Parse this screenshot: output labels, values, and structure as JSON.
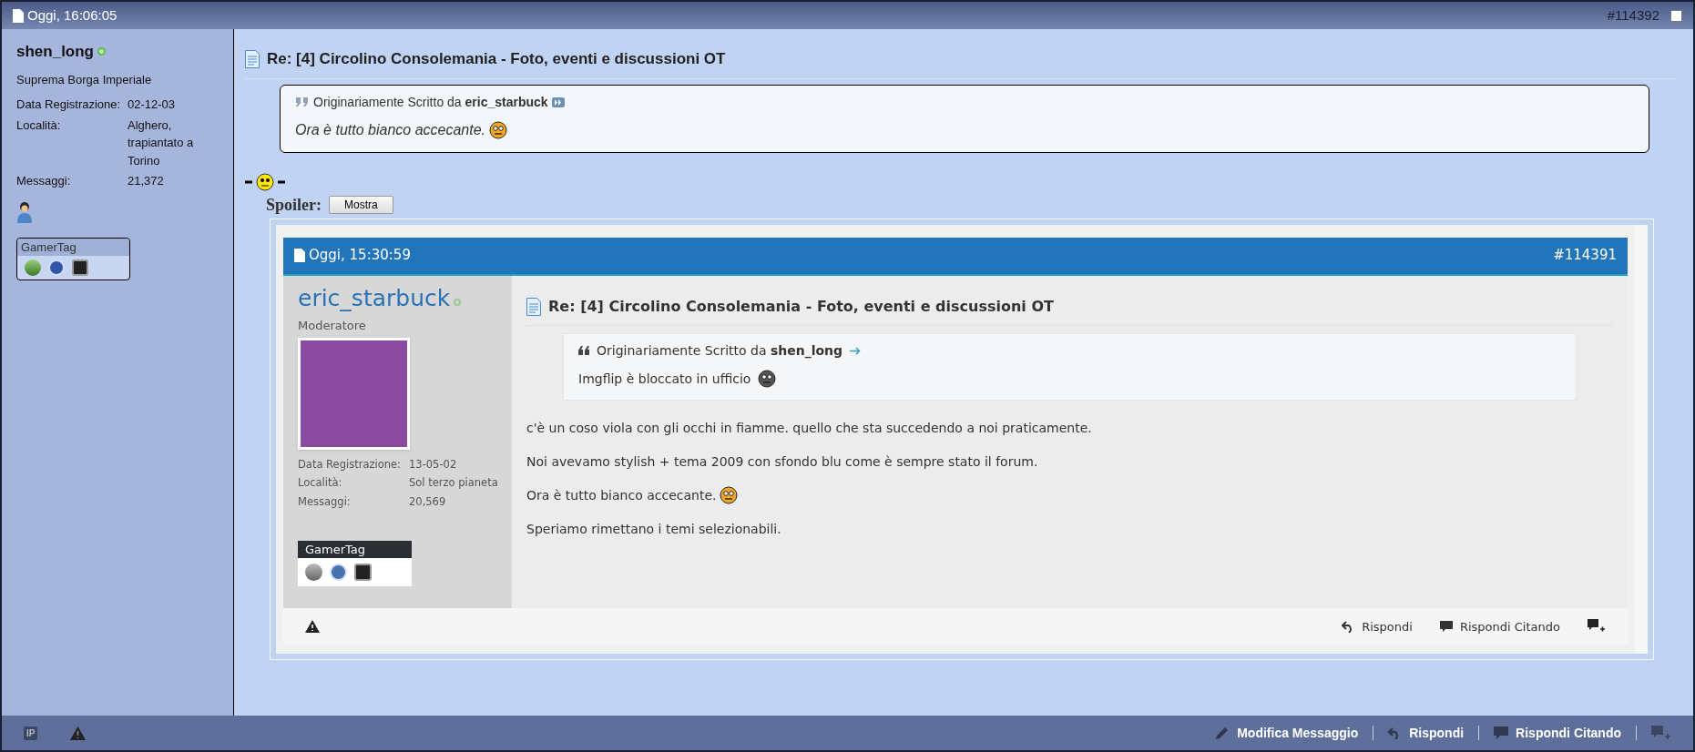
{
  "post": {
    "date": "Oggi, 16:06:05",
    "number": "#114392",
    "checked": false
  },
  "user": {
    "name": "shen_long",
    "online": true,
    "title": "Suprema Borga Imperiale",
    "fields": [
      {
        "label": "Data Registrazione:",
        "value": "02-12-03"
      },
      {
        "label": "Località:",
        "value": "Alghero, trapiantato a Torino"
      },
      {
        "label": "Messaggi:",
        "value": "21,372"
      }
    ],
    "gamertag": "GamerTag"
  },
  "message": {
    "title": "Re: [4] Circolino Consolemania - Foto, eventi e discussioni OT",
    "quote": {
      "prefix": "Originariamente Scritto da",
      "author": "eric_starbuck",
      "text": "Ora è tutto bianco accecante.",
      "emoticon": true
    },
    "spoiler": {
      "label": "Spoiler:",
      "button": "Mostra"
    }
  },
  "embedded_post": {
    "date": "Oggi, 15:30:59",
    "number": "#114391",
    "user": {
      "name": "eric_starbuck",
      "online": true,
      "role": "Moderatore",
      "fields": [
        {
          "label": "Data Registrazione:",
          "value": "13-05-02"
        },
        {
          "label": "Località:",
          "value": "Sol terzo pianeta"
        },
        {
          "label": "Messaggi:",
          "value": "20,569"
        }
      ],
      "gamertag": "GamerTag"
    },
    "title": "Re: [4] Circolino Consolemania - Foto, eventi e discussioni OT",
    "quote": {
      "prefix": "Originariamente Scritto da",
      "author": "shen_long",
      "text": "Imgflip è bloccato in ufficio",
      "emoticon": true
    },
    "paragraphs": [
      {
        "text": "c'è un coso viola con gli occhi in fiamme. quello che sta succedendo a noi praticamente.",
        "emoticon": false
      },
      {
        "text": "Noi avevamo stylish + tema 2009 con sfondo blu come è sempre stato il forum.",
        "emoticon": false
      },
      {
        "text": "Ora è tutto bianco accecante.",
        "emoticon": true
      },
      {
        "text": "Speriamo rimettano i temi selezionabili.",
        "emoticon": false
      }
    ],
    "actions": [
      "Rispondi",
      "Rispondi Citando"
    ]
  },
  "footer": {
    "ip_label": "IP",
    "actions": [
      "Modifica Messaggio",
      "Rispondi",
      "Rispondi Citando"
    ]
  }
}
